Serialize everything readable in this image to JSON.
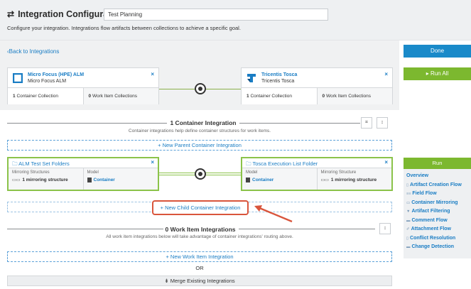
{
  "header": {
    "title_icon": "⇄",
    "title": "Integration Configuration",
    "name_value": "Test Planning",
    "description": "Configure your integration. Integrations flow artifacts between collections to achieve a specific goal."
  },
  "nav": {
    "back_label": "Back to Integrations",
    "back_icon": "‹"
  },
  "collections": {
    "left": {
      "name": "Micro Focus (HPE) ALM",
      "sub": "Micro Focus ALM",
      "container_count": "1",
      "container_label": "Container Collection",
      "work_count": "0",
      "work_label": "Work Item Collections"
    },
    "right": {
      "name": "Tricentis Tosca",
      "sub": "Tricentis Tosca",
      "container_count": "1",
      "container_label": "Container Collection",
      "work_count": "0",
      "work_label": "Work Item Collections"
    },
    "close_glyph": "×"
  },
  "container_section": {
    "title": "1 Container Integration",
    "subtitle": "Container integrations help define container structures for work items.",
    "new_parent_label": "+ New Parent Container Integration",
    "tool1": "⌗",
    "tool2": "↕",
    "left_card": {
      "icon": "🗀",
      "name": "ALM Test Set Folders",
      "col1_label": "Mirroring Structures",
      "col1_value": "1 mirroring structure",
      "col2_label": "Model",
      "col2_value": "Container"
    },
    "right_card": {
      "icon": "🗀",
      "name": "Tosca Execution List Folder",
      "col1_label": "Model",
      "col1_value": "Container",
      "col2_label": "Mirroring Structure",
      "col2_value": "1 mirroring structure"
    },
    "new_child_label": "+ New Child Container Integration"
  },
  "work_section": {
    "title": "0 Work Item Integrations",
    "subtitle": "All work item integrations below will take advantage of container integrations' routing above.",
    "new_work_label": "+ New Work Item Integration",
    "or_label": "OR",
    "merge_label": "⇟ Merge Existing Integrations",
    "tool1": "↕"
  },
  "sidebar": {
    "done_label": "Done",
    "run_all_label": "▸ Run All",
    "run_label": "Run",
    "items": [
      {
        "icon": "",
        "label": "Overview"
      },
      {
        "icon": "▯",
        "label": "Artifact Creation Flow"
      },
      {
        "icon": "≡≡",
        "label": "Field Flow"
      },
      {
        "icon": "▭",
        "label": "Container Mirroring"
      },
      {
        "icon": "▼",
        "label": "Artifact Filtering"
      },
      {
        "icon": "▬",
        "label": "Comment Flow"
      },
      {
        "icon": "✐",
        "label": "Attachment Flow"
      },
      {
        "icon": "▯",
        "label": "Conflict Resolution"
      },
      {
        "icon": "▬",
        "label": "Change Detection"
      }
    ]
  },
  "colors": {
    "accent_blue": "#1a8ac9",
    "run_green": "#7cb82f",
    "highlight_red": "#d9553c"
  }
}
